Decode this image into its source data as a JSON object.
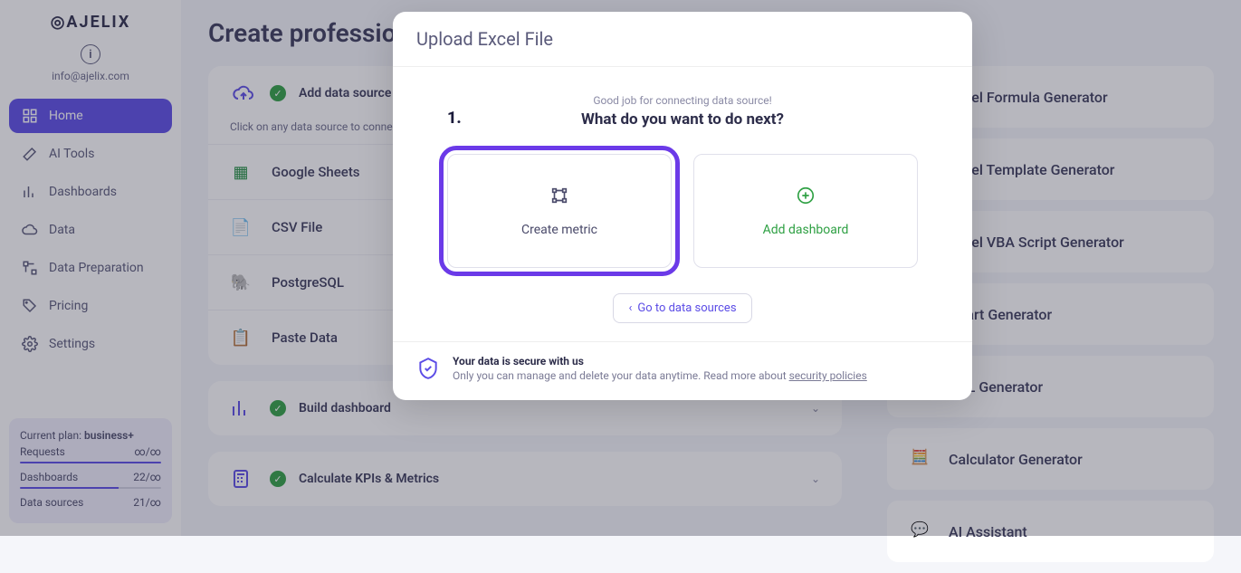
{
  "brand": "AJELIX",
  "user_email": "info@ajelix.com",
  "sidebar": {
    "items": [
      {
        "label": "Home",
        "active": true
      },
      {
        "label": "AI Tools"
      },
      {
        "label": "Dashboards"
      },
      {
        "label": "Data"
      },
      {
        "label": "Data Preparation"
      },
      {
        "label": "Pricing"
      },
      {
        "label": "Settings"
      }
    ]
  },
  "plan": {
    "prefix": "Current plan: ",
    "name": "business+",
    "rows": [
      {
        "label": "Requests",
        "value": "∞/∞"
      },
      {
        "label": "Dashboards",
        "value": "22/∞"
      },
      {
        "label": "Data sources",
        "value": "21/∞"
      }
    ]
  },
  "page_title": "Create professional reports with free AI tools",
  "steps": {
    "add_source": "Add data source",
    "hint": "Click on any data source to connect",
    "sources": [
      {
        "label": "Google Sheets"
      },
      {
        "label": "CSV File"
      },
      {
        "label": "PostgreSQL"
      },
      {
        "label": "Paste Data"
      }
    ],
    "build": "Build dashboard",
    "kpi": "Calculate KPIs & Metrics"
  },
  "tools": [
    "Excel Formula Generator",
    "Excel Template Generator",
    "Excel VBA Script Generator",
    "Chart Generator",
    "SQL Generator",
    "Calculator Generator",
    "AI Assistant"
  ],
  "modal": {
    "title": "Upload Excel File",
    "step_num": "1.",
    "good_job": "Good job for connecting data source!",
    "what_next": "What do you want to do next?",
    "create_metric": "Create metric",
    "add_dashboard": "Add dashboard",
    "go_back": "Go to data sources",
    "secure_title": "Your data is secure with us",
    "secure_text_a": "Only you can manage and delete your data anytime. Read more about ",
    "secure_link": "security policies"
  }
}
